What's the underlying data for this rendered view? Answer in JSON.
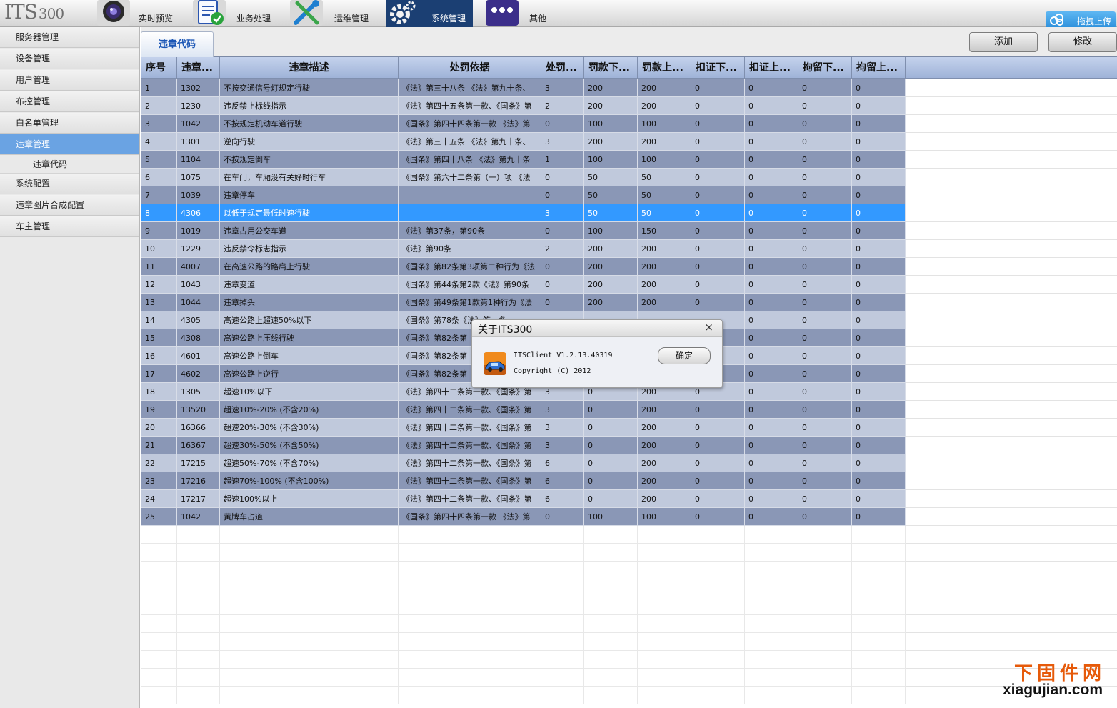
{
  "app": {
    "logo_main": "ITS",
    "logo_num": "300"
  },
  "nav": [
    {
      "label": "实时预览",
      "icon": "camera-lens-icon"
    },
    {
      "label": "业务处理",
      "icon": "document-check-icon"
    },
    {
      "label": "运维管理",
      "icon": "wrench-screwdriver-icon"
    },
    {
      "label": "系统管理",
      "icon": "gear-icon",
      "active": true
    },
    {
      "label": "其他",
      "icon": "dots-icon"
    }
  ],
  "upload_label": "拖拽上传",
  "sidebar": {
    "items": [
      {
        "label": "服务器管理"
      },
      {
        "label": "设备管理"
      },
      {
        "label": "用户管理"
      },
      {
        "label": "布控管理"
      },
      {
        "label": "白名单管理"
      },
      {
        "label": "违章管理",
        "active": true
      },
      {
        "label": "违章代码",
        "sub": true
      },
      {
        "label": "系统配置"
      },
      {
        "label": "违章图片合成配置"
      },
      {
        "label": "车主管理"
      }
    ]
  },
  "tab_label": "违章代码",
  "toolbar": {
    "add_label": "添加",
    "edit_label": "修改"
  },
  "table": {
    "columns": [
      "序号",
      "违章...",
      "违章描述",
      "处罚依据",
      "处罚...",
      "罚款下...",
      "罚款上...",
      "扣证下...",
      "扣证上...",
      "拘留下...",
      "拘留上..."
    ],
    "selected_row": 8,
    "rows": [
      [
        "1",
        "1302",
        "不按交通信号灯规定行驶",
        "《法》第三十八条 《法》第九十条、",
        "3",
        "200",
        "200",
        "0",
        "0",
        "0",
        "0"
      ],
      [
        "2",
        "1230",
        "违反禁止标线指示",
        "《法》第四十五条第一款、《国条》第",
        "2",
        "200",
        "200",
        "0",
        "0",
        "0",
        "0"
      ],
      [
        "3",
        "1042",
        "不按规定机动车道行驶",
        "《国条》第四十四条第一款 《法》第",
        "0",
        "100",
        "100",
        "0",
        "0",
        "0",
        "0"
      ],
      [
        "4",
        "1301",
        "逆向行驶",
        "《法》第三十五条 《法》第九十条、",
        "3",
        "200",
        "200",
        "0",
        "0",
        "0",
        "0"
      ],
      [
        "5",
        "1104",
        "不按规定倒车",
        "《国条》第四十八条 《法》第九十条",
        "1",
        "100",
        "100",
        "0",
        "0",
        "0",
        "0"
      ],
      [
        "6",
        "1075",
        "在车门，车厢没有关好时行车",
        "《国条》第六十二条第（一）项 《法",
        "0",
        "50",
        "50",
        "0",
        "0",
        "0",
        "0"
      ],
      [
        "7",
        "1039",
        "违章停车",
        "",
        "0",
        "50",
        "50",
        "0",
        "0",
        "0",
        "0"
      ],
      [
        "8",
        "4306",
        "以低于规定最低时速行驶",
        "",
        "3",
        "50",
        "50",
        "0",
        "0",
        "0",
        "0"
      ],
      [
        "9",
        "1019",
        "违章占用公交车道",
        "《法》第37条，第90条",
        "0",
        "100",
        "150",
        "0",
        "0",
        "0",
        "0"
      ],
      [
        "10",
        "1229",
        "违反禁令标志指示",
        "《法》第90条",
        "2",
        "200",
        "200",
        "0",
        "0",
        "0",
        "0"
      ],
      [
        "11",
        "4007",
        "在高速公路的路肩上行驶",
        "《国条》第82条第3项第二种行为《法",
        "0",
        "200",
        "200",
        "0",
        "0",
        "0",
        "0"
      ],
      [
        "12",
        "1043",
        "违章变道",
        "《国条》第44条第2款《法》第90条",
        "0",
        "200",
        "200",
        "0",
        "0",
        "0",
        "0"
      ],
      [
        "13",
        "1044",
        "违章掉头",
        "《国条》第49条第1款第1种行为《法",
        "0",
        "200",
        "200",
        "0",
        "0",
        "0",
        "0"
      ],
      [
        "14",
        "4305",
        "高速公路上超速50%以下",
        "《国条》第78条《法》第一条",
        "",
        "",
        "",
        "",
        "0",
        "0",
        "0"
      ],
      [
        "15",
        "4308",
        "高速公路上压线行驶",
        "《国条》第82条第",
        "",
        "",
        "",
        "",
        "0",
        "0",
        "0"
      ],
      [
        "16",
        "4601",
        "高速公路上倒车",
        "《国条》第82条第",
        "",
        "",
        "",
        "",
        "0",
        "0",
        "0"
      ],
      [
        "17",
        "4602",
        "高速公路上逆行",
        "《国条》第82条第",
        "",
        "",
        "",
        "",
        "0",
        "0",
        "0"
      ],
      [
        "18",
        "1305",
        "超速10%以下",
        "《法》第四十二条第一款、《国条》第",
        "3",
        "0",
        "200",
        "0",
        "0",
        "0",
        "0"
      ],
      [
        "19",
        "13520",
        "超速10%-20% (不含20%)",
        "《法》第四十二条第一款、《国条》第",
        "3",
        "0",
        "200",
        "0",
        "0",
        "0",
        "0"
      ],
      [
        "20",
        "16366",
        "超速20%-30% (不含30%)",
        "《法》第四十二条第一款、《国条》第",
        "3",
        "0",
        "200",
        "0",
        "0",
        "0",
        "0"
      ],
      [
        "21",
        "16367",
        "超速30%-50% (不含50%)",
        "《法》第四十二条第一款、《国条》第",
        "3",
        "0",
        "200",
        "0",
        "0",
        "0",
        "0"
      ],
      [
        "22",
        "17215",
        "超速50%-70% (不含70%)",
        "《法》第四十二条第一款、《国条》第",
        "6",
        "0",
        "200",
        "0",
        "0",
        "0",
        "0"
      ],
      [
        "23",
        "17216",
        "超速70%-100% (不含100%)",
        "《法》第四十二条第一款、《国条》第",
        "6",
        "0",
        "200",
        "0",
        "0",
        "0",
        "0"
      ],
      [
        "24",
        "17217",
        "超速100%以上",
        "《法》第四十二条第一款、《国条》第",
        "6",
        "0",
        "200",
        "0",
        "0",
        "0",
        "0"
      ],
      [
        "25",
        "1042",
        "黄牌车占道",
        "《国条》第四十四条第一款 《法》第",
        "0",
        "100",
        "100",
        "0",
        "0",
        "0",
        "0"
      ]
    ]
  },
  "dialog": {
    "title": "关于ITS300",
    "close_symbol": "×",
    "line1": "ITSClient V1.2.13.40319",
    "line2": "Copyright (C) 2012",
    "ok_label": "确定"
  },
  "watermark": {
    "top": "下固件网",
    "bottom": "xiagujian.com"
  },
  "colors": {
    "row_odd": "#8a97b6",
    "row_even": "#c0c9dc",
    "row_selected": "#3399ff",
    "nav_active": "#1b3f73",
    "sidebar_active": "#6aa3e3",
    "watermark_accent": "#e65a0a"
  }
}
